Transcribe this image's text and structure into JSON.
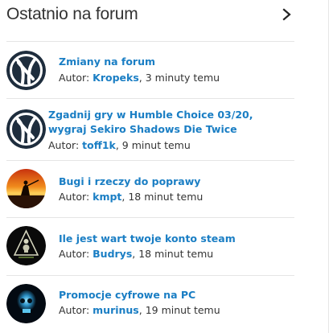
{
  "widget": {
    "title": "Ostatnio na forum",
    "more_icon": "chevron-right-icon"
  },
  "items": [
    {
      "topic": "Zmiany na forum",
      "author_prefix": "Autor: ",
      "author": "Kropeks",
      "time": ", 3 minuty temu",
      "avatar_icon": "ps-logo-avatar"
    },
    {
      "topic": "Zgadnij gry w Humble Choice 03/20, wygraj Sekiro Shadows Die Twice",
      "author_prefix": "Autor: ",
      "author": "toff1k",
      "time": ", 9 minut temu",
      "avatar_icon": "ps-logo-avatar"
    },
    {
      "topic": "Bugi i rzeczy do poprawy",
      "author_prefix": "Autor: ",
      "author": "kmpt",
      "time": ", 18 minut temu",
      "avatar_icon": "sunset-samurai-avatar"
    },
    {
      "topic": "Ile jest wart twoje konto steam",
      "author_prefix": "Autor: ",
      "author": "Budrys",
      "time": ", 18 minut temu",
      "avatar_icon": "skull-pyramid-avatar"
    },
    {
      "topic": "Promocje cyfrowe na PC",
      "author_prefix": "Autor: ",
      "author": "murinus",
      "time": ", 19 minut temu",
      "avatar_icon": "blue-skull-avatar"
    }
  ],
  "colors": {
    "link": "#1a7ec4",
    "text": "#333333",
    "divider": "#e5e5e5",
    "avatar_dark": "#1e2d3d"
  }
}
